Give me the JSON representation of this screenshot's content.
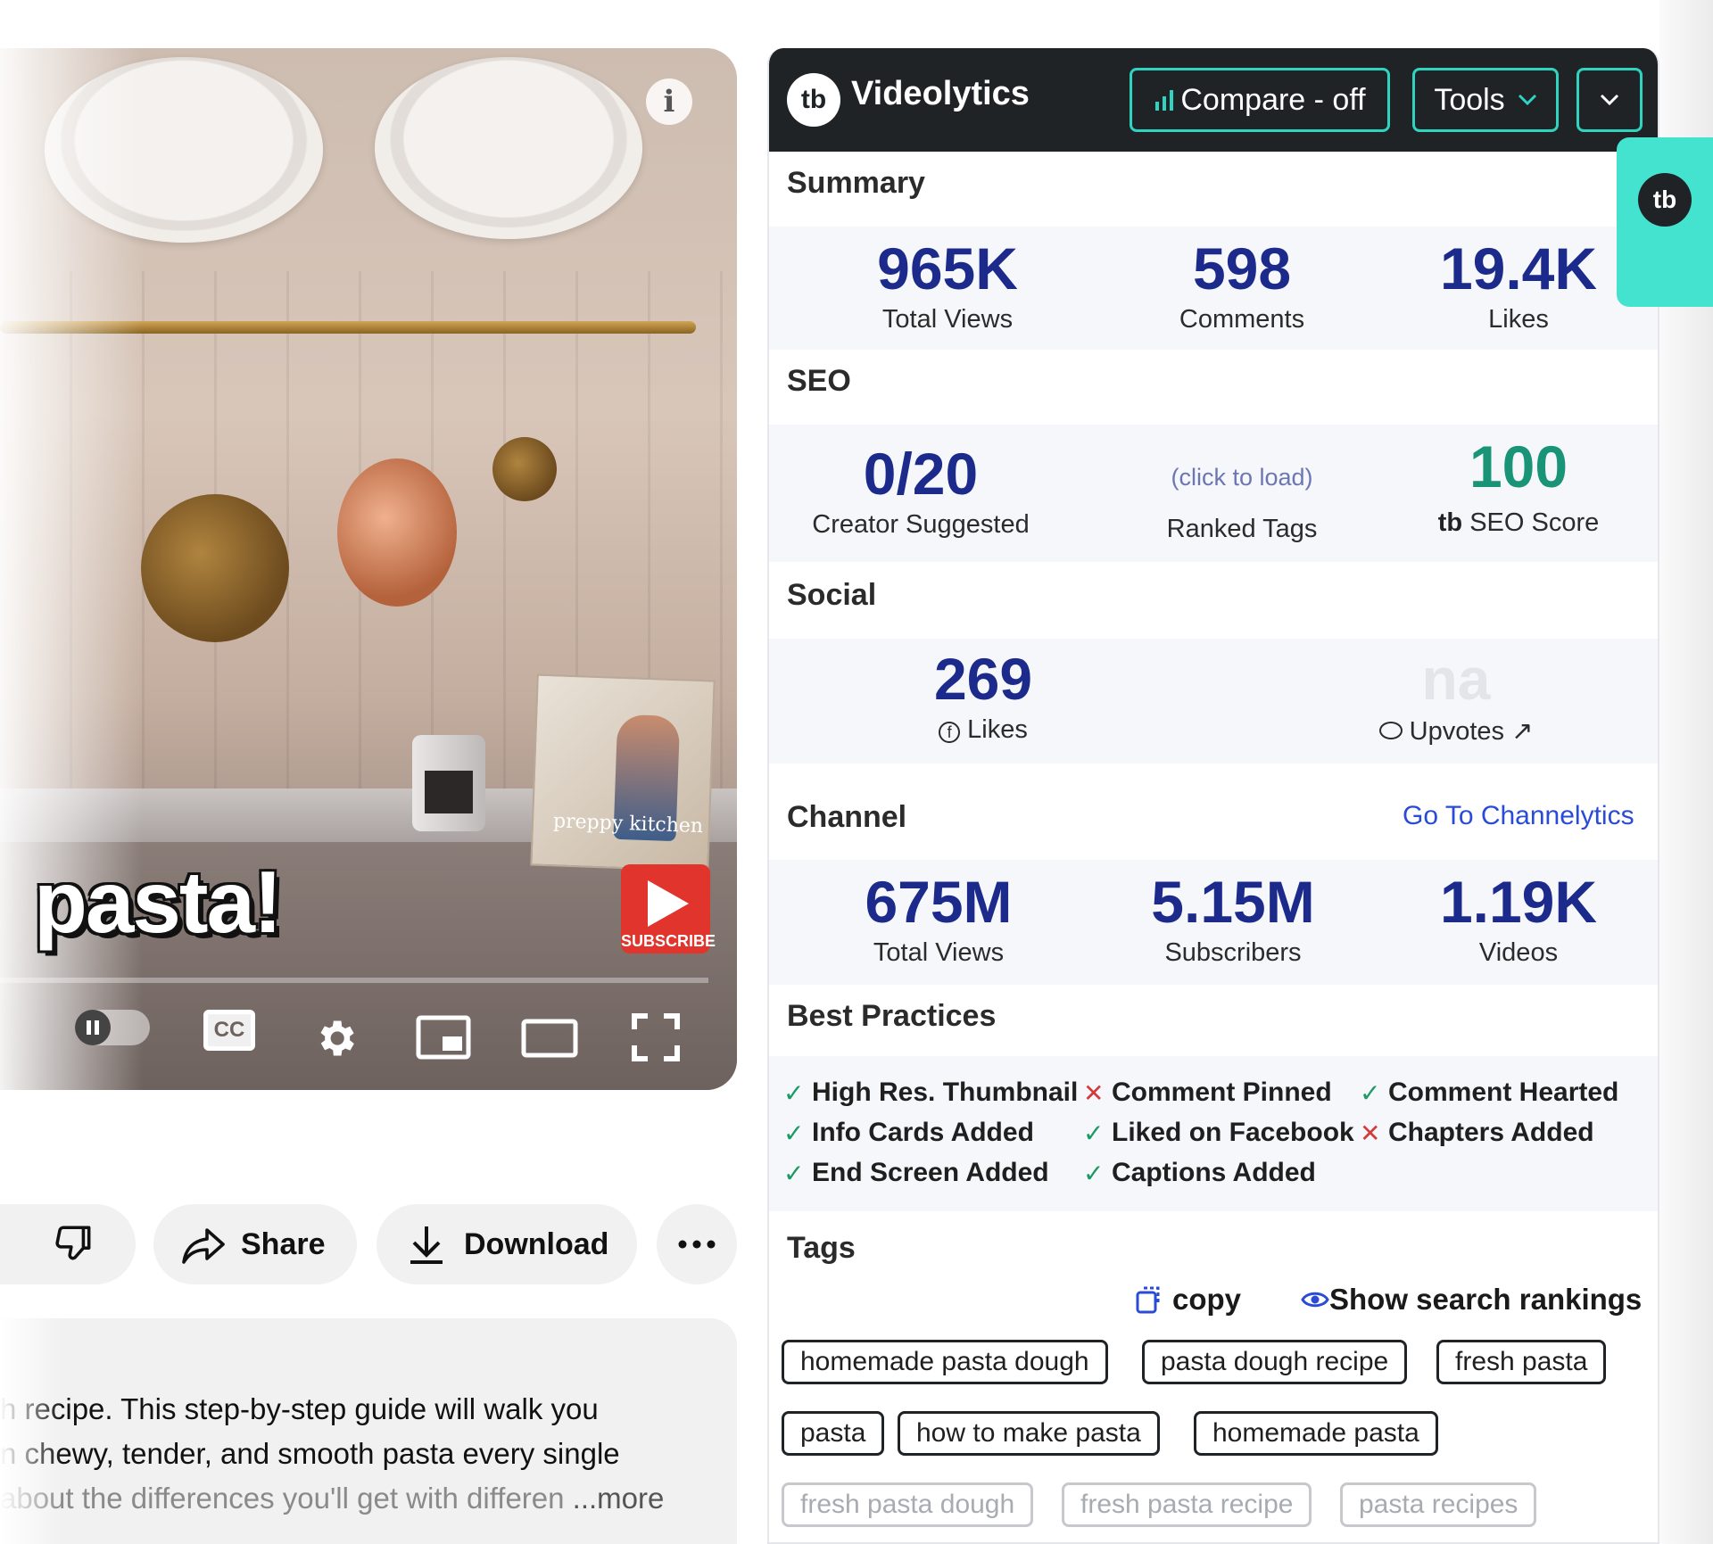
{
  "video": {
    "overlay_caption": "pasta!",
    "subscribe_label": "SUBSCRIBE",
    "book_title": "preppy kitchen",
    "cc_label": "CC",
    "progress_fraction": 0.0
  },
  "actions": {
    "share_label": "Share",
    "download_label": "Download"
  },
  "description": {
    "line1": "h recipe. This step-by-step guide will walk you",
    "line2": "n chewy, tender, and smooth pasta every single",
    "line3": "about the differences you'll get with differen",
    "more_label": "...more"
  },
  "panel": {
    "brand": "Videolytics",
    "logo_text": "tb",
    "compare_label": "Compare - off",
    "tools_label": "Tools",
    "summary": {
      "title": "Summary",
      "views_value": "965K",
      "views_label": "Total Views",
      "comments_value": "598",
      "comments_label": "Comments",
      "likes_value": "19.4K",
      "likes_label": "Likes"
    },
    "seo": {
      "title": "SEO",
      "creator_value": "0/20",
      "creator_label": "Creator Suggested",
      "ranked_link": "(click to load)",
      "ranked_label": "Ranked Tags",
      "score_value": "100",
      "score_label": "SEO Score"
    },
    "social": {
      "title": "Social",
      "fb_value": "269",
      "fb_label": "Likes",
      "reddit_value": "na",
      "reddit_label": "Upvotes"
    },
    "channel": {
      "title": "Channel",
      "link": "Go To Channelytics",
      "views_value": "675M",
      "views_label": "Total Views",
      "subs_value": "5.15M",
      "subs_label": "Subscribers",
      "videos_value": "1.19K",
      "videos_label": "Videos"
    },
    "best_practices": {
      "title": "Best Practices",
      "items": [
        {
          "label": "High Res. Thumbnail",
          "ok": true
        },
        {
          "label": "Comment Pinned",
          "ok": false
        },
        {
          "label": "Comment Hearted",
          "ok": true
        },
        {
          "label": "Info Cards Added",
          "ok": true
        },
        {
          "label": "Liked on Facebook",
          "ok": true
        },
        {
          "label": "Chapters Added",
          "ok": false
        },
        {
          "label": "End Screen Added",
          "ok": true
        },
        {
          "label": "Captions Added",
          "ok": true
        }
      ]
    },
    "tags": {
      "title": "Tags",
      "copy_label": "copy",
      "rankings_label": "Show search rankings",
      "list": [
        "homemade pasta dough",
        "pasta dough recipe",
        "fresh pasta",
        "pasta",
        "how to make pasta",
        "homemade pasta",
        "fresh pasta dough",
        "fresh pasta recipe",
        "pasta recipes"
      ]
    }
  },
  "side_tab": {
    "logo_text": "tb"
  },
  "colors": {
    "stat_blue": "#1c2a8c",
    "seo_green": "#1a9477",
    "header_bg": "#1f2326",
    "accent_teal": "#2fd4c0",
    "link_blue": "#2a4bd6"
  }
}
